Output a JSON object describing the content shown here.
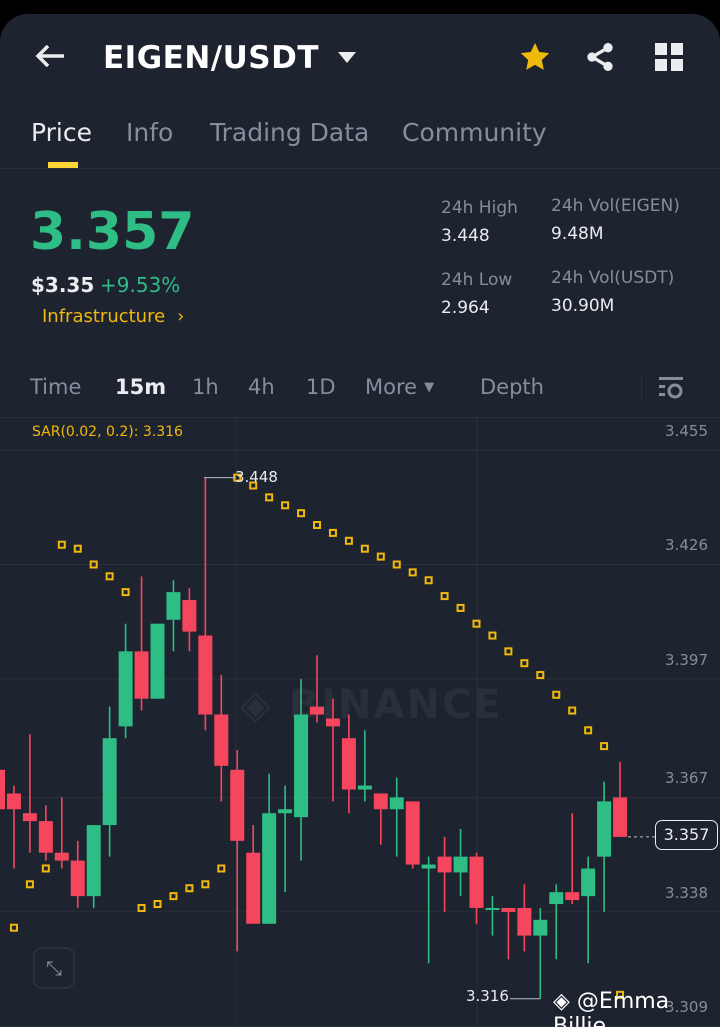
{
  "header": {
    "title": "EIGEN/USDT",
    "back_icon": "arrow-left-icon",
    "favorite_icon": "star-icon",
    "share_icon": "share-icon",
    "grid_icon": "grid-icon",
    "accent": "#f0b90b"
  },
  "tabs": [
    {
      "label": "Price",
      "active": true
    },
    {
      "label": "Info"
    },
    {
      "label": "Trading Data"
    },
    {
      "label": "Community"
    }
  ],
  "ticker": {
    "last_price": "3.357",
    "usd_price": "$3.35",
    "change": "+9.53%",
    "category": "Infrastructure",
    "high_label": "24h High",
    "high": "3.448",
    "low_label": "24h Low",
    "low": "2.964",
    "vol_base_label": "24h Vol(EIGEN)",
    "vol_base": "9.48M",
    "vol_quote_label": "24h Vol(USDT)",
    "vol_quote": "30.90M"
  },
  "timeframes": {
    "items": [
      "Time",
      "15m",
      "1h",
      "4h",
      "1D",
      "More"
    ],
    "active": "15m",
    "depth": "Depth"
  },
  "chart_data": {
    "type": "candlestick",
    "indicator_label": "SAR(0.02, 0.2): 3.316",
    "y_ticks": [
      "3.455",
      "3.426",
      "3.397",
      "3.367",
      "3.338",
      "3.309"
    ],
    "ylim": [
      3.309,
      3.455
    ],
    "high_marker": "3.448",
    "low_marker": "3.316",
    "current_price": "3.357",
    "up_color": "#2ebd85",
    "down_color": "#f6465d",
    "sar_color": "#f0b90b",
    "ohlc": [
      [
        3.374,
        3.376,
        3.362,
        3.364
      ],
      [
        3.368,
        3.37,
        3.349,
        3.364
      ],
      [
        3.363,
        3.383,
        3.353,
        3.361
      ],
      [
        3.361,
        3.365,
        3.351,
        3.353
      ],
      [
        3.353,
        3.367,
        3.349,
        3.351
      ],
      [
        3.351,
        3.356,
        3.339,
        3.342
      ],
      [
        3.342,
        3.36,
        3.339,
        3.36
      ],
      [
        3.36,
        3.39,
        3.352,
        3.382
      ],
      [
        3.385,
        3.411,
        3.382,
        3.404
      ],
      [
        3.404,
        3.423,
        3.389,
        3.392
      ],
      [
        3.392,
        3.411,
        3.392,
        3.411
      ],
      [
        3.412,
        3.422,
        3.404,
        3.419
      ],
      [
        3.417,
        3.42,
        3.404,
        3.409
      ],
      [
        3.408,
        3.448,
        3.384,
        3.388
      ],
      [
        3.388,
        3.398,
        3.366,
        3.375
      ],
      [
        3.374,
        3.379,
        3.328,
        3.356
      ],
      [
        3.353,
        3.36,
        3.335,
        3.335
      ],
      [
        3.335,
        3.373,
        3.335,
        3.363
      ],
      [
        3.363,
        3.37,
        3.343,
        3.364
      ],
      [
        3.362,
        3.397,
        3.351,
        3.388
      ],
      [
        3.39,
        3.403,
        3.386,
        3.388
      ],
      [
        3.387,
        3.392,
        3.366,
        3.385
      ],
      [
        3.382,
        3.388,
        3.363,
        3.369
      ],
      [
        3.369,
        3.384,
        3.366,
        3.37
      ],
      [
        3.368,
        3.368,
        3.355,
        3.364
      ],
      [
        3.364,
        3.372,
        3.352,
        3.367
      ],
      [
        3.366,
        3.366,
        3.349,
        3.35
      ],
      [
        3.349,
        3.352,
        3.325,
        3.35
      ],
      [
        3.352,
        3.357,
        3.338,
        3.348
      ],
      [
        3.348,
        3.359,
        3.342,
        3.352
      ],
      [
        3.352,
        3.353,
        3.335,
        3.339
      ],
      [
        3.339,
        3.342,
        3.332,
        3.339
      ],
      [
        3.339,
        3.339,
        3.326,
        3.338
      ],
      [
        3.339,
        3.345,
        3.328,
        3.332
      ],
      [
        3.332,
        3.339,
        3.316,
        3.336
      ],
      [
        3.34,
        3.345,
        3.326,
        3.343
      ],
      [
        3.343,
        3.363,
        3.34,
        3.341
      ],
      [
        3.342,
        3.352,
        3.325,
        3.349
      ],
      [
        3.352,
        3.371,
        3.338,
        3.366
      ],
      [
        3.367,
        3.376,
        3.357,
        3.357
      ]
    ],
    "sar": [
      null,
      3.334,
      3.345,
      3.349,
      3.431,
      3.43,
      3.426,
      3.423,
      3.419,
      3.339,
      3.34,
      3.342,
      3.344,
      3.345,
      3.349,
      3.448,
      3.446,
      3.443,
      3.441,
      3.439,
      3.436,
      3.434,
      3.432,
      3.43,
      3.428,
      3.426,
      3.424,
      3.422,
      3.418,
      3.415,
      3.411,
      3.408,
      3.404,
      3.401,
      3.398,
      3.393,
      3.389,
      3.384,
      3.38,
      3.317
    ]
  },
  "watermark": {
    "brand": "BINANCE",
    "user": "@Emma Billie"
  }
}
